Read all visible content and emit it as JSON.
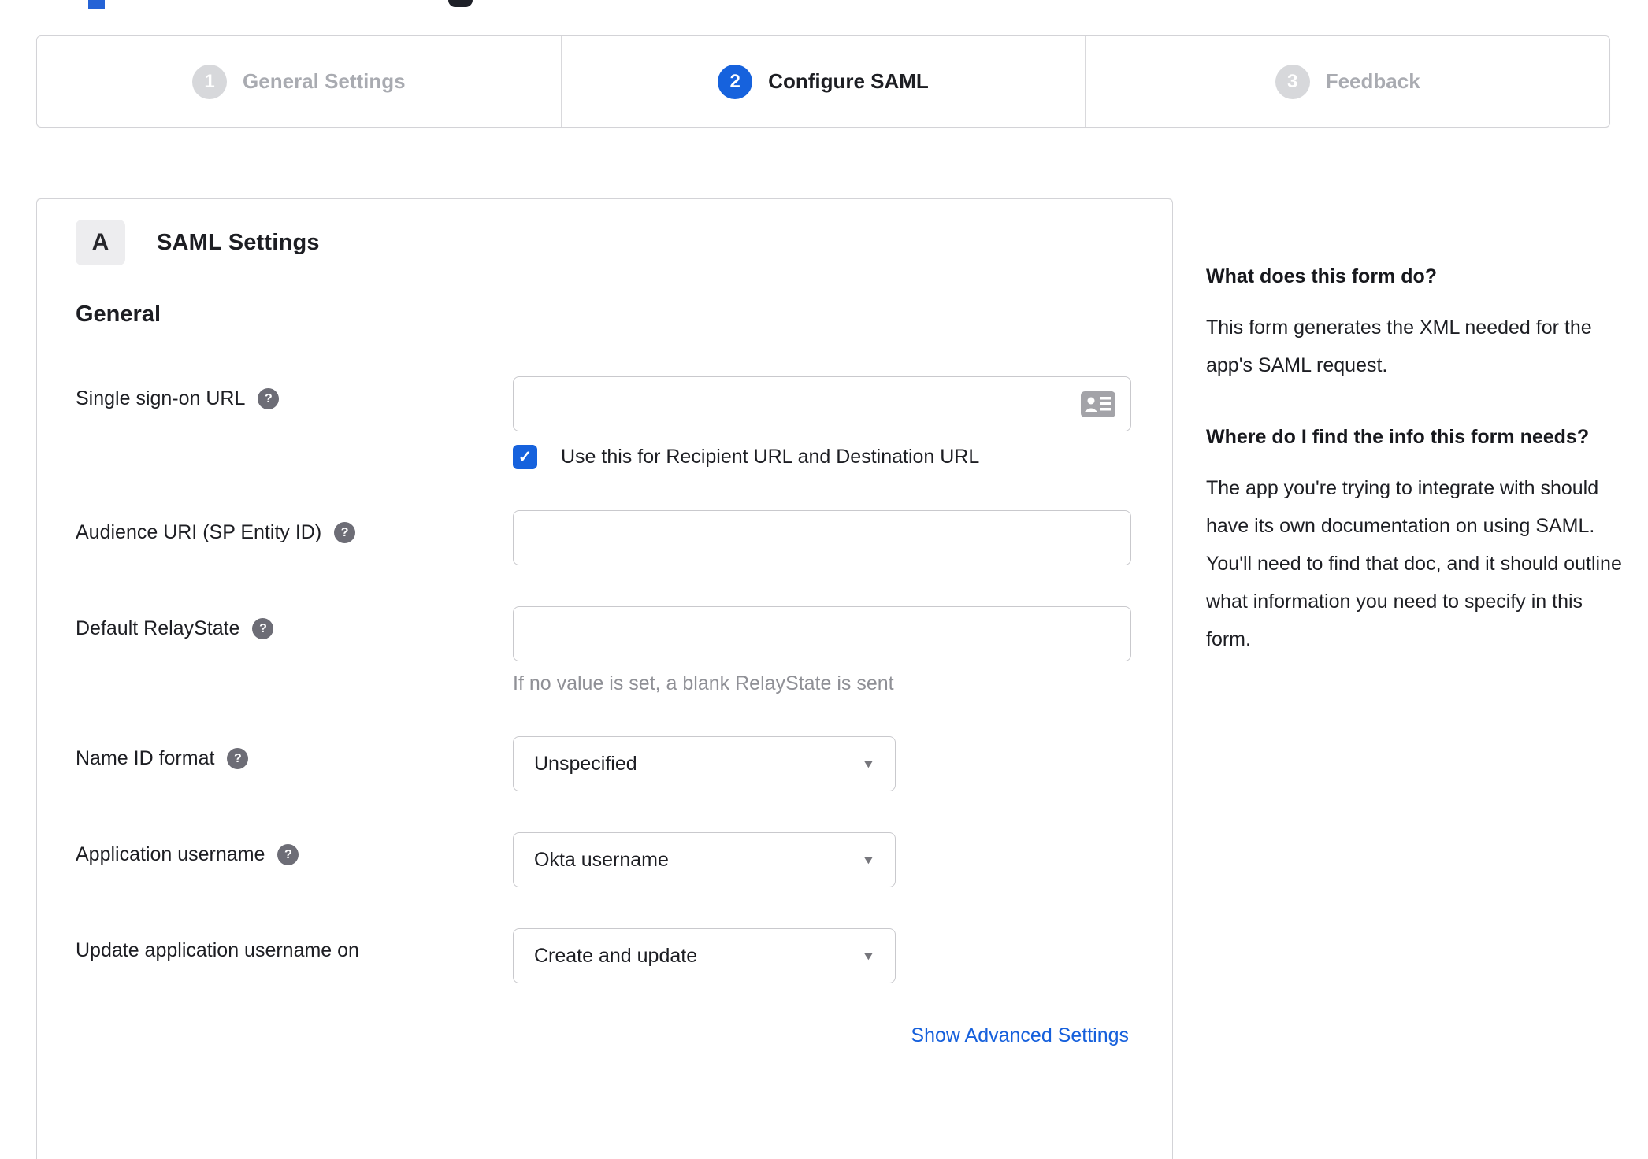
{
  "colors": {
    "accent_blue": "#1662dd",
    "inactive_gray": "#d7d8db",
    "inactive_text": "#a9abb1",
    "text_dark": "#1d1e23",
    "hint_gray": "#8f9096"
  },
  "icons": {
    "help_glyph": "?",
    "check_glyph": "✓",
    "caret_glyph": "▼"
  },
  "stepper": {
    "steps": [
      {
        "number": "1",
        "label": "General Settings",
        "state": "inactive"
      },
      {
        "number": "2",
        "label": "Configure SAML",
        "state": "active"
      },
      {
        "number": "3",
        "label": "Feedback",
        "state": "inactive"
      }
    ]
  },
  "panel": {
    "section_badge": "A",
    "section_title": "SAML Settings",
    "subsection_title": "General",
    "fields": {
      "sso_url": {
        "label": "Single sign-on URL",
        "value": "",
        "checkbox_label": "Use this for Recipient URL and Destination URL",
        "checked": true
      },
      "audience_uri": {
        "label": "Audience URI (SP Entity ID)",
        "value": ""
      },
      "default_relay_state": {
        "label": "Default RelayState",
        "value": "",
        "hint": "If no value is set, a blank RelayState is sent"
      },
      "name_id_format": {
        "label": "Name ID format",
        "value": "Unspecified"
      },
      "application_username": {
        "label": "Application username",
        "value": "Okta username"
      },
      "update_app_username": {
        "label": "Update application username on",
        "value": "Create and update"
      }
    },
    "advanced_link": "Show Advanced Settings"
  },
  "sidebar": {
    "sections": [
      {
        "heading": "What does this form do?",
        "body": "This form generates the XML needed for the app's SAML request."
      },
      {
        "heading": "Where do I find the info this form needs?",
        "body": "The app you're trying to integrate with should have its own documentation on using SAML. You'll need to find that doc, and it should outline what information you need to specify in this form."
      }
    ]
  }
}
